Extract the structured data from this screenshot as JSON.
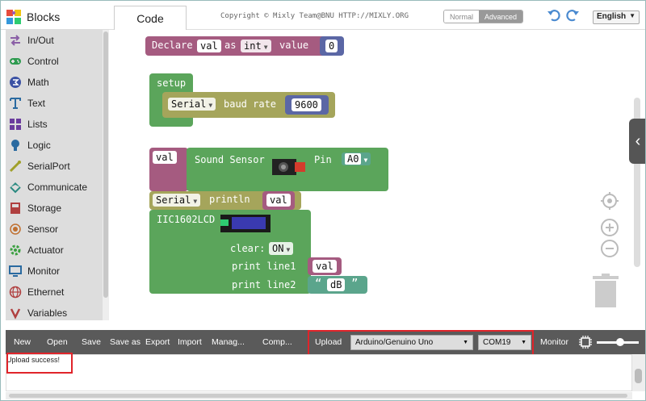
{
  "header": {
    "blocks_tab": "Blocks",
    "code_tab": "Code",
    "copyright": "Copyright © Mixly Team@BNU HTTP://MIXLY.ORG",
    "mode_normal": "Normal",
    "mode_advanced": "Advanced",
    "language": "English"
  },
  "sidebar": {
    "items": [
      {
        "label": "In/Out",
        "icon": "in-out-icon",
        "color": "#8a5fa6"
      },
      {
        "label": "Control",
        "icon": "gamepad-icon",
        "color": "#2e9b50"
      },
      {
        "label": "Math",
        "icon": "math-icon",
        "color": "#3b52a4"
      },
      {
        "label": "Text",
        "icon": "text-icon",
        "color": "#2a6aa0"
      },
      {
        "label": "Lists",
        "icon": "lists-icon",
        "color": "#6b3c9e"
      },
      {
        "label": "Logic",
        "icon": "bulb-icon",
        "color": "#2a6aa0"
      },
      {
        "label": "SerialPort",
        "icon": "serialport-icon",
        "color": "#a0a02a"
      },
      {
        "label": "Communicate",
        "icon": "communicate-icon",
        "color": "#2a8a80"
      },
      {
        "label": "Storage",
        "icon": "storage-icon",
        "color": "#b04040"
      },
      {
        "label": "Sensor",
        "icon": "sensor-icon",
        "color": "#c07030"
      },
      {
        "label": "Actuator",
        "icon": "actuator-icon",
        "color": "#3aa040"
      },
      {
        "label": "Monitor",
        "icon": "monitor-icon",
        "color": "#2a6aa0"
      },
      {
        "label": "Ethernet",
        "icon": "globe-icon",
        "color": "#b04040"
      },
      {
        "label": "Variables",
        "icon": "variables-icon",
        "color": "#b04040"
      }
    ]
  },
  "workspace": {
    "declare": {
      "kw": "Declare",
      "var": "val",
      "as": "as",
      "type": "int",
      "value_kw": "value",
      "value": "0"
    },
    "setup": {
      "label": "setup",
      "serial": "Serial",
      "baud_label": "baud rate",
      "baud": "9600"
    },
    "sound": {
      "var": "val",
      "label": "Sound Sensor",
      "pin_label": "Pin",
      "pin": "A0"
    },
    "println": {
      "serial": "Serial",
      "label": "println",
      "arg": "val"
    },
    "lcd": {
      "label": "IIC1602LCD",
      "clear_label": "clear:",
      "clear_value": "ON",
      "line1_label": "print line1",
      "line1_value": "val",
      "line2_label": "print line2",
      "line2_value": "dB"
    }
  },
  "toolbar": {
    "new": "New",
    "open": "Open",
    "save": "Save",
    "save_as": "Save as",
    "export": "Export",
    "import": "Import",
    "manage": "Manag...",
    "compile": "Comp...",
    "upload": "Upload",
    "board": "Arduino/Genuino Uno",
    "port": "COM19",
    "monitor": "Monitor"
  },
  "console": {
    "message": "Upload success!"
  },
  "colors": {
    "highlight": "#e0242a",
    "setup_green": "#5ba55b",
    "serial_olive": "#a5a55b",
    "var_pink": "#a55b80",
    "declare_pink": "#a55b80",
    "math_blue": "#5b67a5",
    "text_teal": "#5ba58c"
  }
}
